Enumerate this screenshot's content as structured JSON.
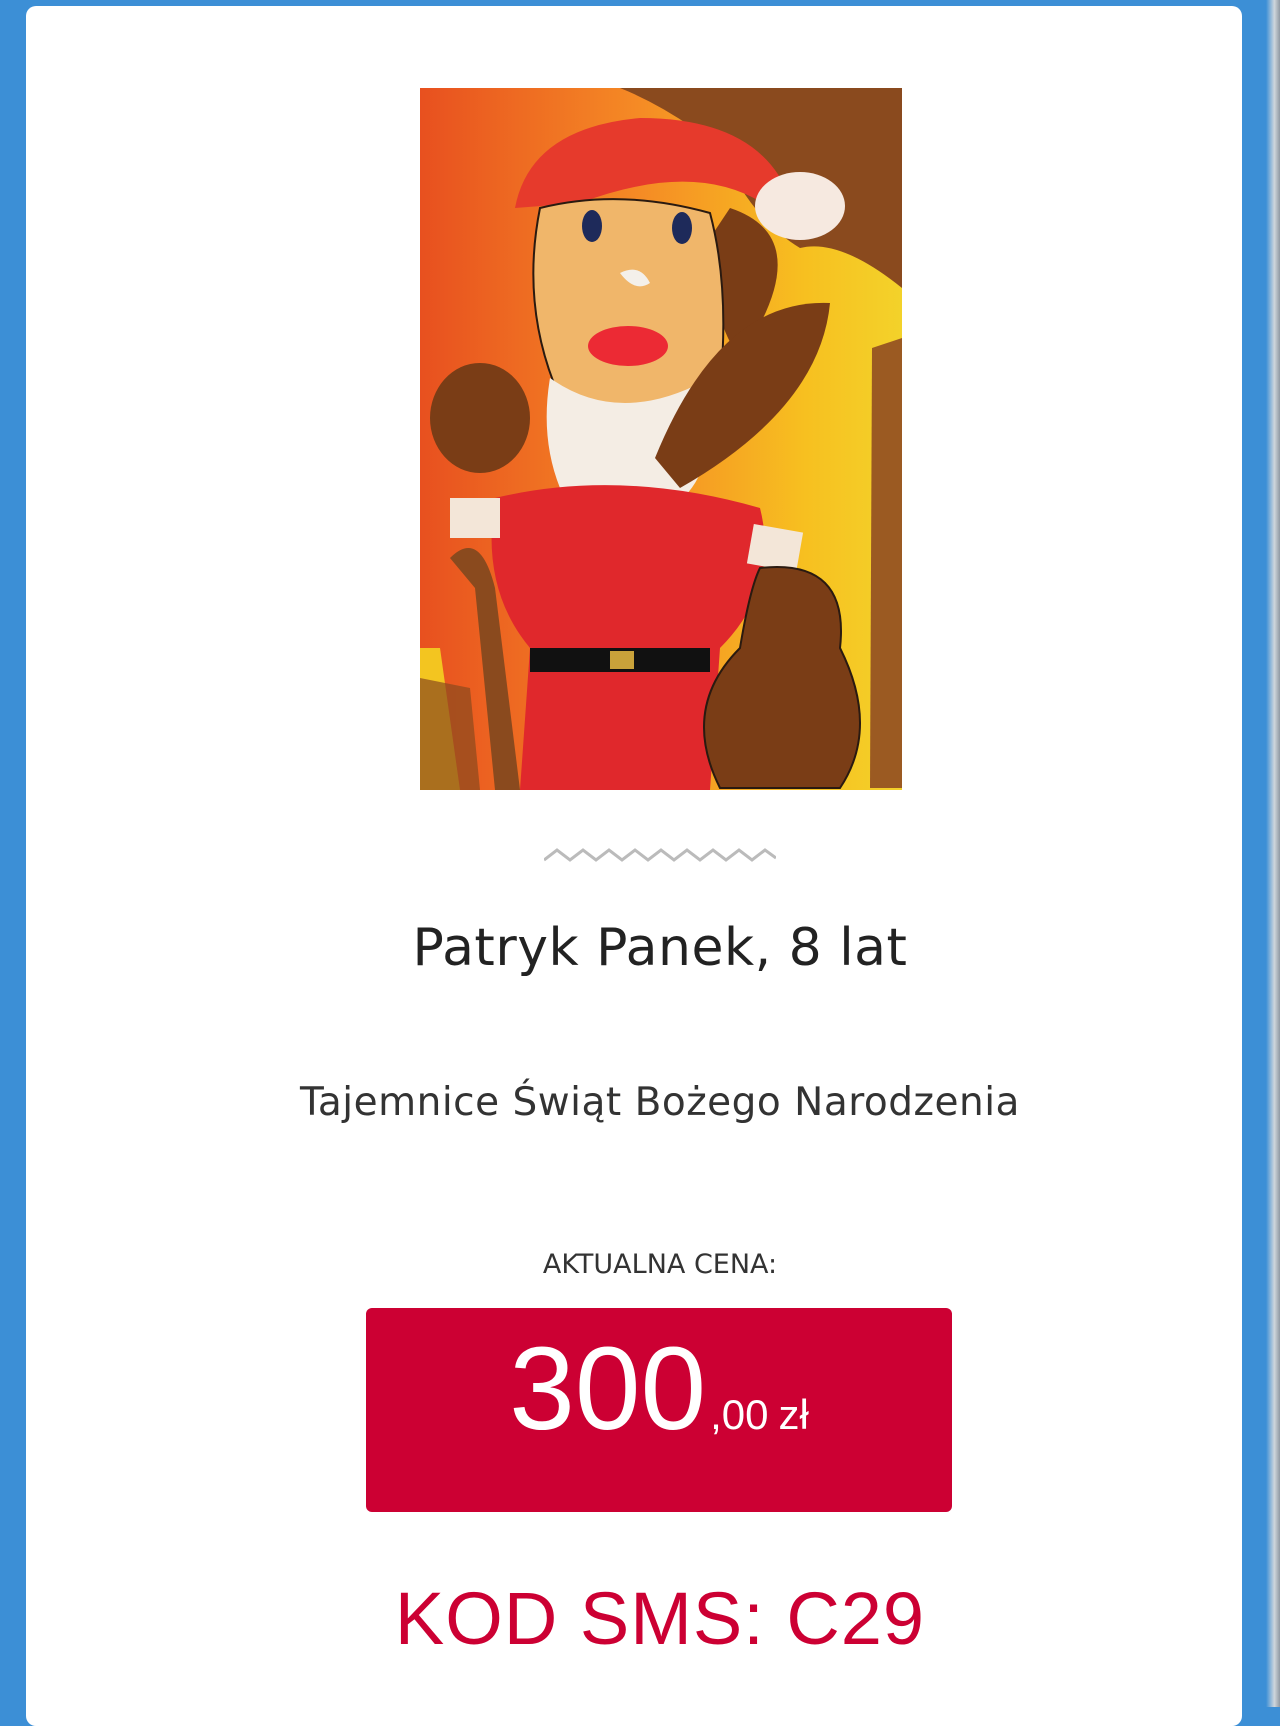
{
  "artwork": {
    "author": "Patryk Panek, 8 lat",
    "title": "Tajemnice Świąt Bożego Narodzenia"
  },
  "price": {
    "label": "AKTUALNA CENA:",
    "main": "300",
    "decimals": ",00",
    "currency": "zł"
  },
  "sms": {
    "text": "KOD SMS: C29"
  },
  "colors": {
    "background": "#3c8fd6",
    "accent": "#cc0033",
    "card": "#ffffff"
  }
}
